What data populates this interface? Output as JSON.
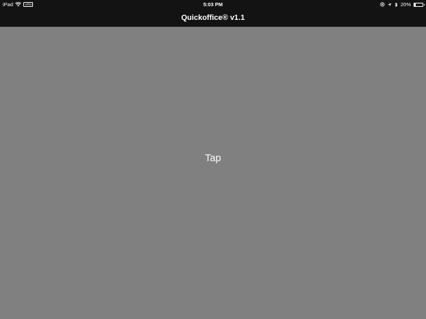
{
  "status_bar": {
    "device": "iPad",
    "vpn": "VPN",
    "time": "5:03 PM",
    "battery": "20%",
    "battery_level": 0.2
  },
  "nav": {
    "title": "Quickoffice® v1.1"
  },
  "main": {
    "tap_label": "Tap"
  },
  "colors": {
    "bars": "#131313",
    "background": "#808080",
    "text": "#ffffff"
  },
  "icons": [
    "wifi-icon",
    "orientation-lock-icon",
    "location-arrow-icon",
    "bluetooth-icon",
    "battery-icon"
  ]
}
